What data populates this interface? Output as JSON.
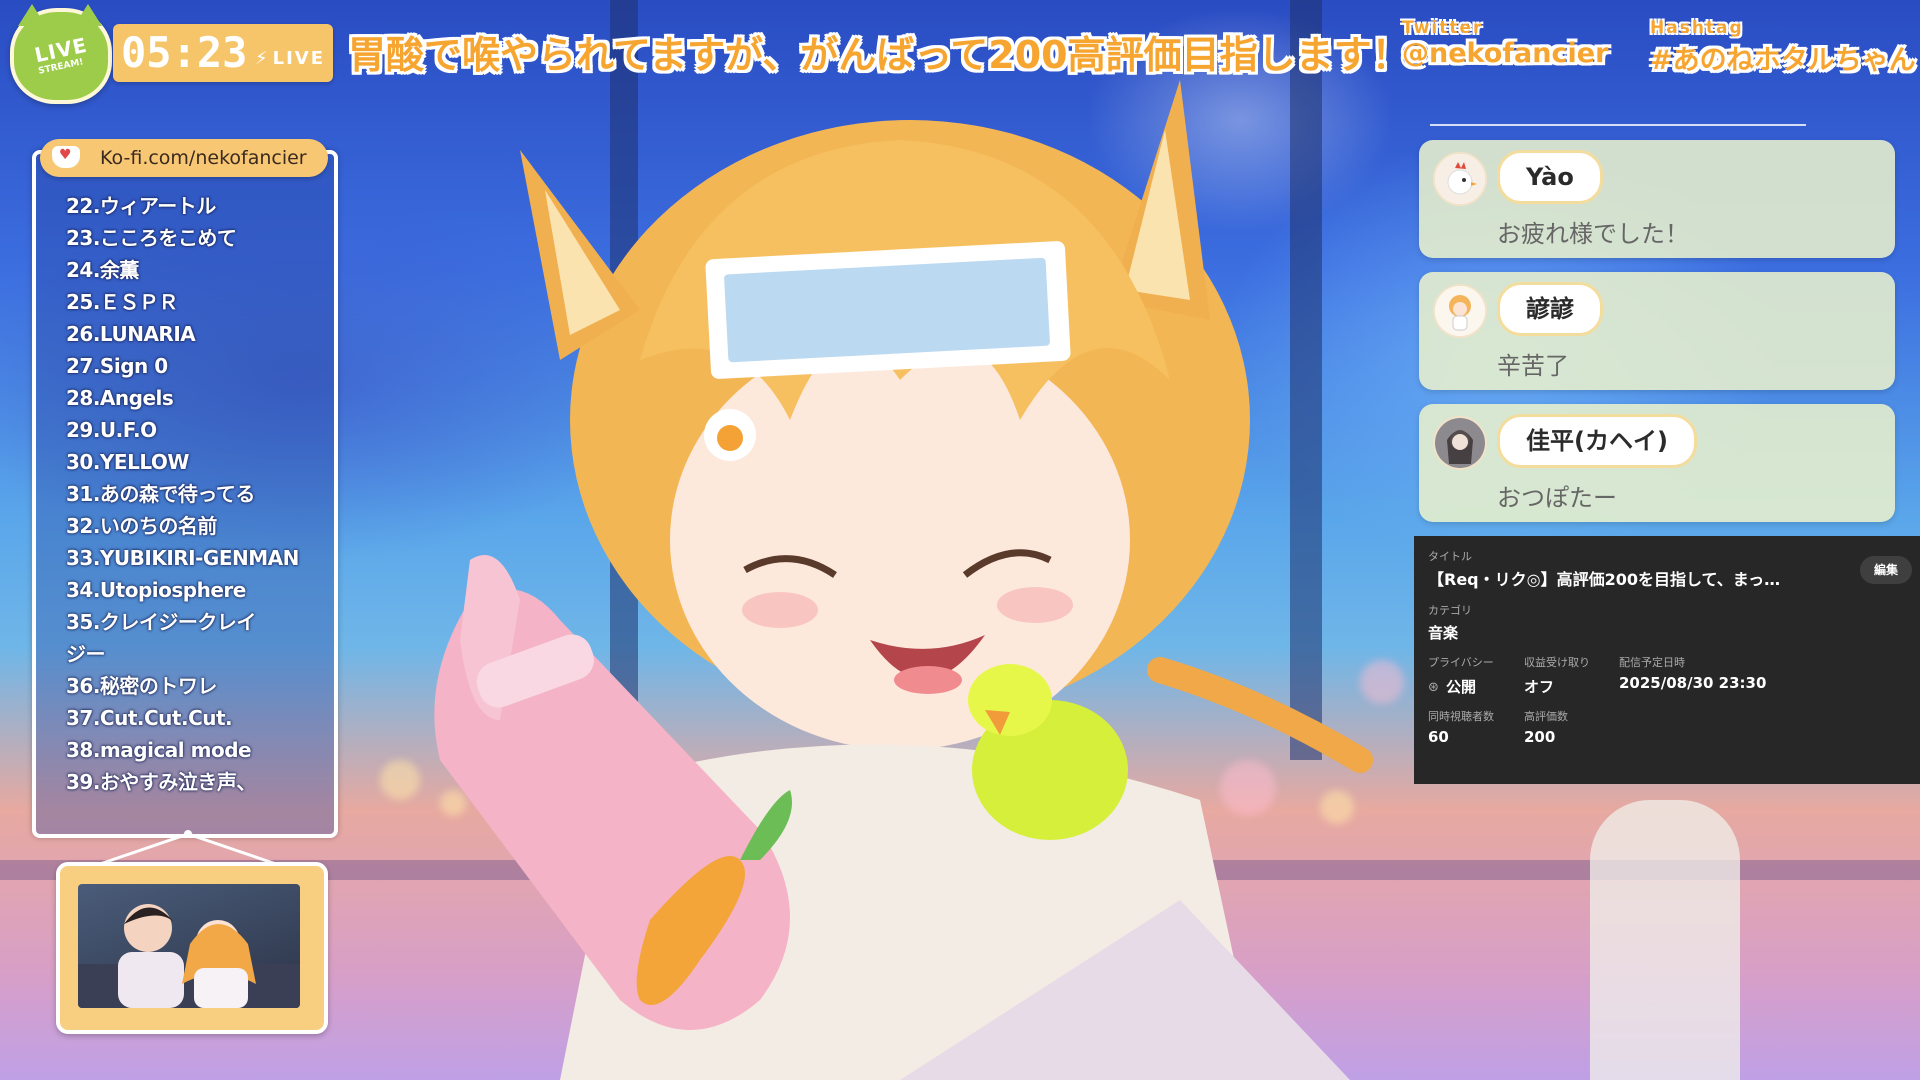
{
  "badge": {
    "live": "LIVE",
    "stream": "STREAM!"
  },
  "clock": {
    "time": "05:23",
    "live": "LIVE"
  },
  "headline": "胃酸で喉やられてますが、がんばって200高評価目指します！",
  "social": {
    "twitter_label": "Twitter",
    "twitter_handle": "@nekofancier",
    "hashtag_label": "Hashtag",
    "hashtag": "#あのねホタルちゃん"
  },
  "kofi": {
    "url": "Ko-fi.com/nekofancier",
    "icon": "kofi-heart-cup-icon"
  },
  "setlist": [
    "22.ウィアートル",
    "23.こころをこめて",
    "24.余薫",
    "25.ＥＳＰＲ",
    "26.LUNARIA",
    "27.Sign 0",
    "28.Angels",
    "29.U.F.O",
    "30.YELLOW",
    "31.あの森で待ってる",
    "32.いのちの名前",
    "33.YUBIKIRI-GENMAN",
    "34.Utopiosphere",
    "35.クレイジークレイ",
    "ジー",
    "36.秘密のトワレ",
    "37.Cut.Cut.Cut.",
    "38.magical mode",
    "39.おやすみ泣き声、"
  ],
  "chat": [
    {
      "name": "Yào",
      "message": "お疲れ様でした！",
      "avatar": "rooster-avatar"
    },
    {
      "name": "諺諺",
      "message": "辛苦了",
      "avatar": "chibi-avatar"
    },
    {
      "name": "佳平(カヘイ)",
      "message": "おつぽたー",
      "avatar": "photo-avatar"
    }
  ],
  "stream_info": {
    "title_label": "タイトル",
    "title": "【Req・リク◎】高評価200を目指して、まっ…",
    "edit": "編集",
    "category_label": "カテゴリ",
    "category": "音楽",
    "privacy_label": "プライバシー",
    "privacy": "公開",
    "monetization_label": "収益受け取り",
    "monetization": "オフ",
    "schedule_label": "配信予定日時",
    "schedule": "2025/08/30 23:30",
    "viewers_label": "同時視聴者数",
    "viewers": "60",
    "likes_label": "高評価数",
    "likes": "200"
  },
  "colors": {
    "accent": "#f6a531",
    "badge_green": "#9ccc4a",
    "clock_bg": "#f6c56a",
    "panel_bg": "#272727"
  }
}
